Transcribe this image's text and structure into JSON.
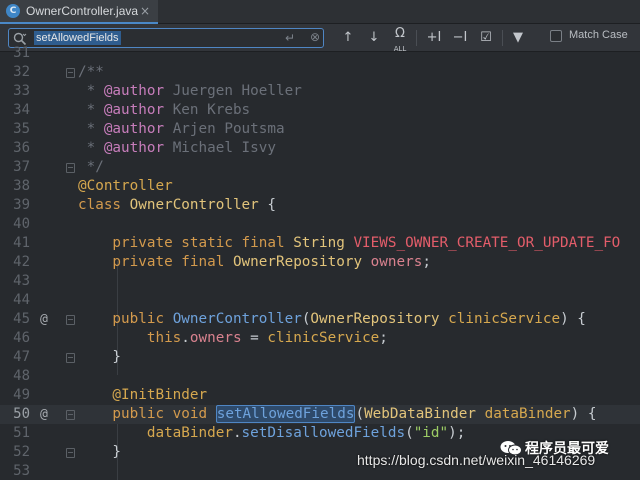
{
  "tab": {
    "icon_letter": "C",
    "title": "OwnerController.java",
    "close": "×"
  },
  "search": {
    "query": "setAllowedFields",
    "enter_glyph": "↵",
    "clear_glyph": "⊗",
    "match_case_label": "Match Case",
    "match_case_checked": false
  },
  "toolbar": {
    "prev": "↑",
    "next": "↓",
    "find_all": "Ω",
    "find_all_sub": "ALL",
    "add_occurrence": "+I",
    "remove_occurrence": "−I",
    "select_all": "☑",
    "filter": "▼"
  },
  "editor": {
    "current_line": "50",
    "lines": [
      {
        "num": "31",
        "tokens": []
      },
      {
        "num": "32",
        "tokens": [
          {
            "t": "/**",
            "c": "cm"
          }
        ]
      },
      {
        "num": "33",
        "tokens": [
          {
            "t": " * ",
            "c": "cm"
          },
          {
            "t": "@author",
            "c": "tag"
          },
          {
            "t": " Juergen Hoeller",
            "c": "cm"
          }
        ]
      },
      {
        "num": "34",
        "tokens": [
          {
            "t": " * ",
            "c": "cm"
          },
          {
            "t": "@author",
            "c": "tag"
          },
          {
            "t": " Ken Krebs",
            "c": "cm"
          }
        ]
      },
      {
        "num": "35",
        "tokens": [
          {
            "t": " * ",
            "c": "cm"
          },
          {
            "t": "@author",
            "c": "tag"
          },
          {
            "t": " Arjen Poutsma",
            "c": "cm"
          }
        ]
      },
      {
        "num": "36",
        "tokens": [
          {
            "t": " * ",
            "c": "cm"
          },
          {
            "t": "@author",
            "c": "tag"
          },
          {
            "t": " Michael Isvy",
            "c": "cm"
          }
        ]
      },
      {
        "num": "37",
        "tokens": [
          {
            "t": " */",
            "c": "cm"
          }
        ]
      },
      {
        "num": "38",
        "tokens": [
          {
            "t": "@Controller",
            "c": "ann"
          }
        ]
      },
      {
        "num": "39",
        "tokens": [
          {
            "t": "class ",
            "c": "kw"
          },
          {
            "t": "OwnerController",
            "c": "cls"
          },
          {
            "t": " {",
            "c": "plain"
          }
        ]
      },
      {
        "num": "40",
        "tokens": []
      },
      {
        "num": "41",
        "tokens": [
          {
            "t": "    private static final ",
            "c": "kw"
          },
          {
            "t": "String ",
            "c": "cls"
          },
          {
            "t": "VIEWS_OWNER_CREATE_OR_UPDATE_FO",
            "c": "cst"
          }
        ]
      },
      {
        "num": "42",
        "tokens": [
          {
            "t": "    private final ",
            "c": "kw"
          },
          {
            "t": "OwnerRepository ",
            "c": "cls"
          },
          {
            "t": "owners",
            "c": "fld"
          },
          {
            "t": ";",
            "c": "plain"
          }
        ]
      },
      {
        "num": "43",
        "tokens": []
      },
      {
        "num": "44",
        "tokens": []
      },
      {
        "num": "45",
        "tokens": [
          {
            "t": "    public ",
            "c": "kw"
          },
          {
            "t": "OwnerController",
            "c": "fn"
          },
          {
            "t": "(",
            "c": "plain"
          },
          {
            "t": "OwnerRepository ",
            "c": "cls"
          },
          {
            "t": "clinicService",
            "c": "ann"
          },
          {
            "t": ") {",
            "c": "plain"
          }
        ]
      },
      {
        "num": "46",
        "tokens": [
          {
            "t": "        this",
            "c": "kw"
          },
          {
            "t": ".",
            "c": "plain"
          },
          {
            "t": "owners",
            "c": "fld"
          },
          {
            "t": " = ",
            "c": "plain"
          },
          {
            "t": "clinicService",
            "c": "ann"
          },
          {
            "t": ";",
            "c": "plain"
          }
        ]
      },
      {
        "num": "47",
        "tokens": [
          {
            "t": "    }",
            "c": "plain"
          }
        ]
      },
      {
        "num": "48",
        "tokens": []
      },
      {
        "num": "49",
        "tokens": [
          {
            "t": "    @InitBinder",
            "c": "ann"
          }
        ]
      },
      {
        "num": "50",
        "tokens": [
          {
            "t": "    public void ",
            "c": "kw"
          },
          {
            "t": "setAllowedFields",
            "c": "fn hl"
          },
          {
            "t": "(",
            "c": "plain"
          },
          {
            "t": "WebDataBinder ",
            "c": "cls"
          },
          {
            "t": "dataBinder",
            "c": "ann"
          },
          {
            "t": ") {",
            "c": "plain"
          }
        ]
      },
      {
        "num": "51",
        "tokens": [
          {
            "t": "        dataBinder",
            "c": "ann"
          },
          {
            "t": ".",
            "c": "plain"
          },
          {
            "t": "setDisallowedFields",
            "c": "fn"
          },
          {
            "t": "(",
            "c": "plain"
          },
          {
            "t": "\"id\"",
            "c": "str"
          },
          {
            "t": ");",
            "c": "plain"
          }
        ]
      },
      {
        "num": "52",
        "tokens": [
          {
            "t": "    }",
            "c": "plain"
          }
        ]
      },
      {
        "num": "53",
        "tokens": []
      }
    ],
    "gutter_marks": {
      "45": "@",
      "50": "@"
    },
    "fold_markers": [
      "32",
      "37",
      "45",
      "47",
      "50",
      "52"
    ]
  },
  "watermark": {
    "name": "程序员最可爱",
    "url": "https://blog.csdn.net/weixin_46146269"
  }
}
